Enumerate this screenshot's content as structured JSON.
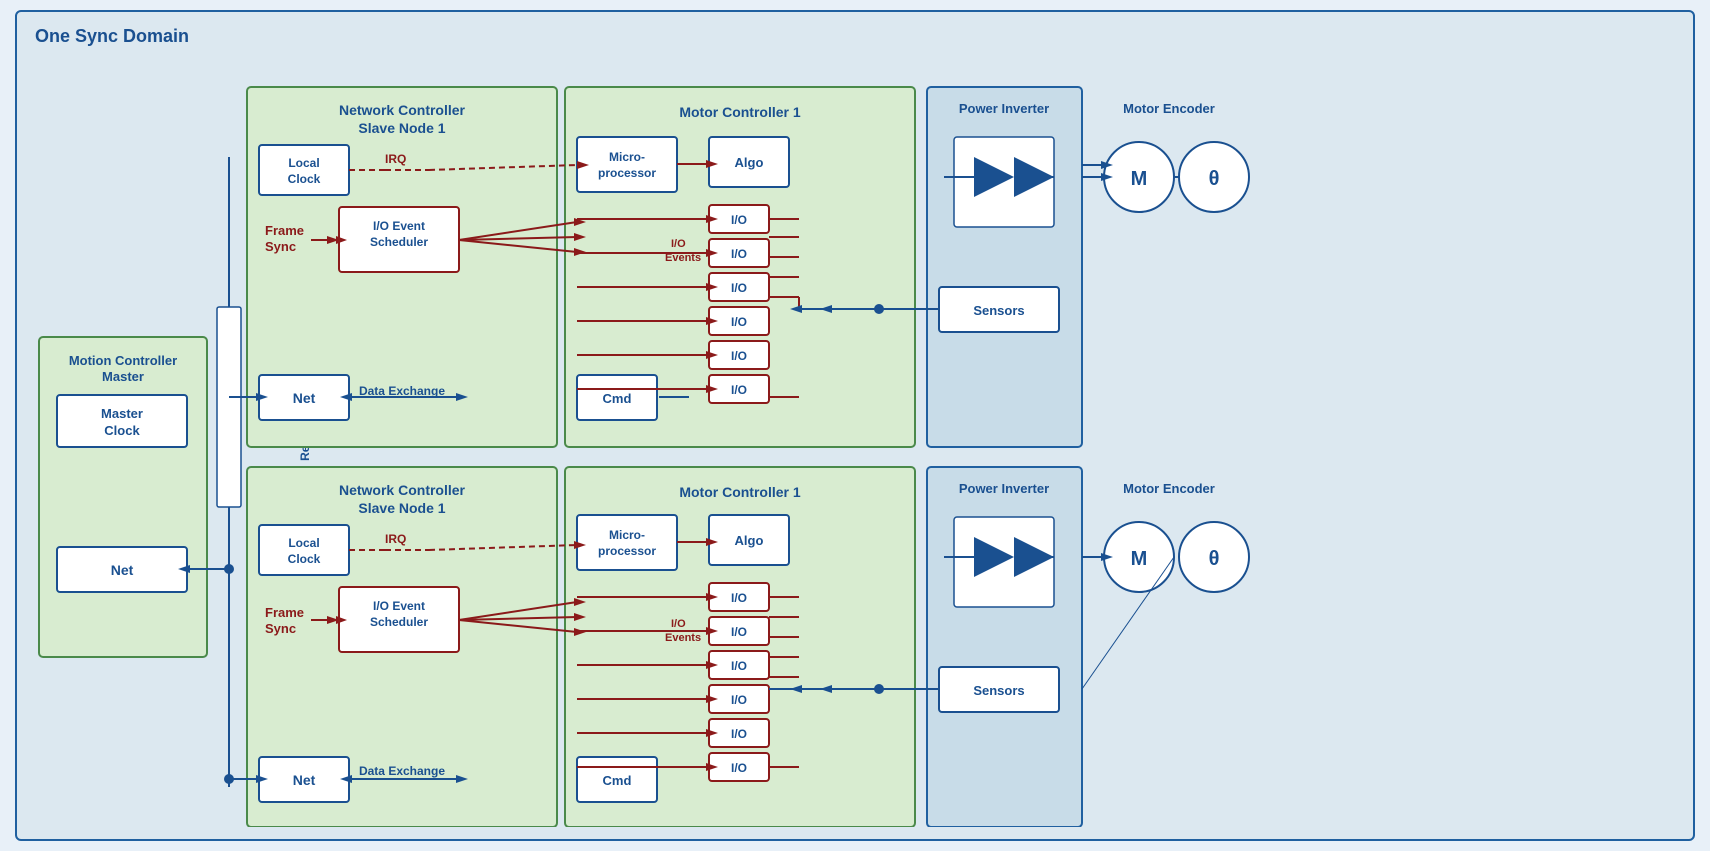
{
  "title": "One Sync Domain",
  "colors": {
    "blue_dark": "#1a5090",
    "blue_border": "#2060a0",
    "green_bg": "#d8ecd0",
    "green_border": "#4a8a4a",
    "blue_bg": "#c8dce8",
    "red_dark": "#8b1a1a",
    "white": "#ffffff",
    "outer_bg": "#dce8f0"
  },
  "motion_controller": {
    "title": "Motion Controller\nMaster",
    "master_clock": "Master\nClock",
    "net": "Net"
  },
  "row1": {
    "nc_title": "Network Controller\nSlave Node 1",
    "local_clock": "Local\nClock",
    "frame_sync": "Frame\nSync",
    "io_scheduler": "I/O Event\nScheduler",
    "irq": "IRQ",
    "net": "Net",
    "data_exchange": "Data Exchange",
    "mc_title": "Motor Controller 1",
    "microprocessor": "Micro-\nprocessor",
    "algo": "Algo",
    "io_events": "I/O\nEvents",
    "cmd": "Cmd",
    "power_inverter": "Power Inverter",
    "sensors": "Sensors",
    "motor_encoder": "Motor Encoder",
    "motor_m": "M",
    "motor_theta": "θ"
  },
  "row2": {
    "nc_title": "Network Controller\nSlave Node 1",
    "local_clock": "Local\nClock",
    "frame_sync": "Frame\nSync",
    "io_scheduler": "I/O Event\nScheduler",
    "irq": "IRQ",
    "net": "Net",
    "data_exchange": "Data Exchange",
    "mc_title": "Motor Controller 1",
    "microprocessor": "Micro-\nprocessor",
    "algo": "Algo",
    "io_events": "I/O\nEvents",
    "cmd": "Cmd",
    "power_inverter": "Power Inverter",
    "sensors": "Sensors",
    "motor_encoder": "Motor Encoder",
    "motor_m": "M",
    "motor_theta": "θ"
  },
  "rtn_label": "Real-Time Network"
}
